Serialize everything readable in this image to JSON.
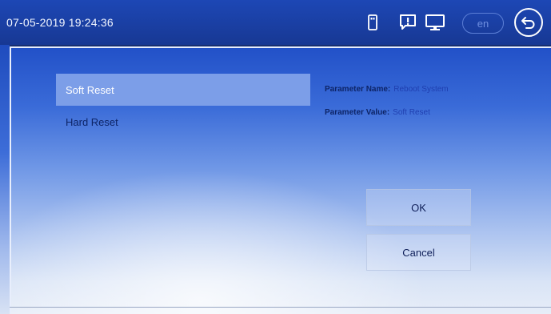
{
  "header": {
    "datetime": "07-05-2019 19:24:36",
    "language": "en",
    "icons": [
      "usb-storage-icon",
      "alert-message-icon",
      "monitor-icon",
      "back-icon"
    ]
  },
  "menu": {
    "items": [
      {
        "label": "Soft Reset",
        "selected": true
      },
      {
        "label": "Hard Reset",
        "selected": false
      }
    ]
  },
  "parameter": {
    "name_label": "Parameter Name:",
    "name_value": "Reboot System",
    "value_label": "Parameter Value:",
    "value_value": "Soft Reset"
  },
  "actions": {
    "ok_label": "OK",
    "cancel_label": "Cancel"
  },
  "colors": {
    "header": "#1a3fa3",
    "selected_item": "#7c9ee8",
    "text_dark": "#0d2466",
    "value_text": "#1f3fb0"
  }
}
